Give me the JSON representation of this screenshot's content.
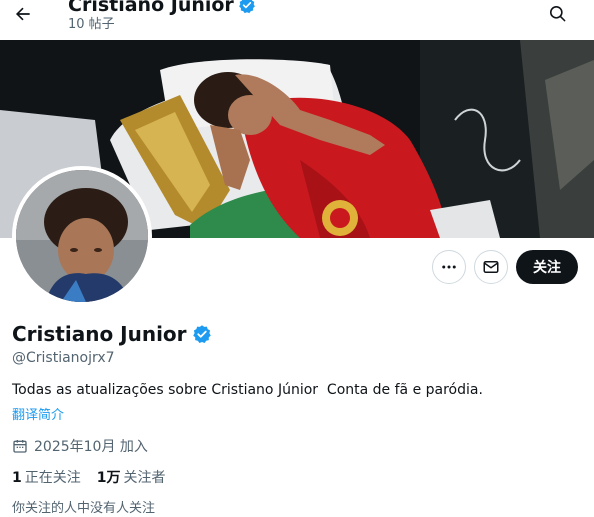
{
  "header": {
    "title": "Cristiano Junior",
    "post_count": "10 帖子"
  },
  "profile": {
    "display_name": "Cristiano Junior",
    "handle": "@Cristianojrx7",
    "bio": "Todas as atualizações sobre Cristiano Júnior  Conta de fã e paródia.",
    "translate_link": "翻译简介",
    "joined": "2025年10月 加入",
    "following_count": "1",
    "following_label": "正在关注",
    "followers_count": "1万",
    "followers_label": "关注者",
    "mutual_note": "你关注的人中没有人关注"
  },
  "actions": {
    "more_icon": "more-icon",
    "message_icon": "message-icon",
    "follow_label": "关注"
  },
  "colors": {
    "accent": "#1d9bf0",
    "verified": "#1d9bf0",
    "follow_bg": "#0f1419",
    "muted": "#536471"
  }
}
